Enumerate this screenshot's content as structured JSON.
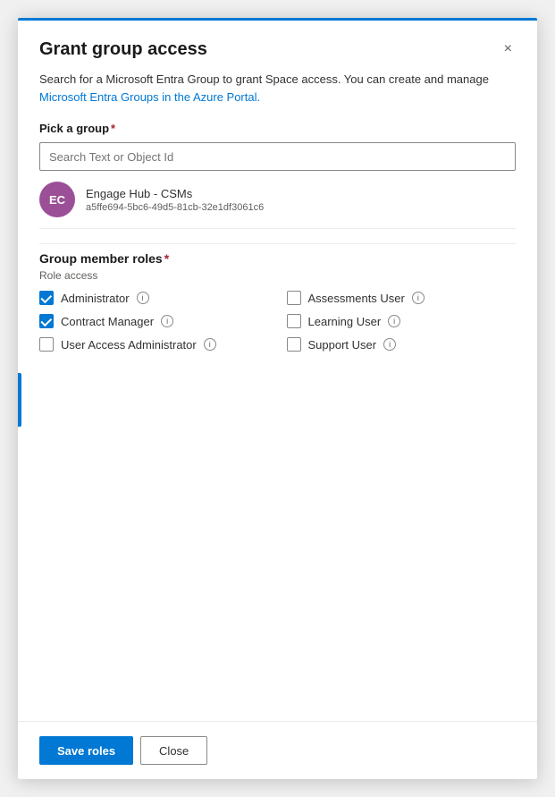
{
  "modal": {
    "title": "Grant group access",
    "close_label": "×"
  },
  "description": {
    "text": "Search for a Microsoft Entra Group to grant Space access. You can create and manage",
    "link_text": "Microsoft Entra Groups in the Azure Portal."
  },
  "group_picker": {
    "label": "Pick a group",
    "required": true,
    "search_placeholder": "Search Text or Object Id"
  },
  "selected_group": {
    "initials": "EC",
    "name": "Engage Hub - CSMs",
    "id": "a5ffe694-5bc6-49d5-81cb-32e1df3061c6"
  },
  "roles_section": {
    "label": "Group member roles",
    "required": true,
    "role_access_label": "Role access"
  },
  "roles": [
    {
      "id": "administrator",
      "label": "Administrator",
      "checked": true,
      "col": 1
    },
    {
      "id": "assessments-user",
      "label": "Assessments User",
      "checked": false,
      "col": 2
    },
    {
      "id": "contract-manager",
      "label": "Contract Manager",
      "checked": true,
      "col": 1
    },
    {
      "id": "learning-user",
      "label": "Learning User",
      "checked": false,
      "col": 2
    },
    {
      "id": "user-access-administrator",
      "label": "User Access Administrator",
      "checked": false,
      "col": 1
    },
    {
      "id": "support-user",
      "label": "Support User",
      "checked": false,
      "col": 2
    }
  ],
  "footer": {
    "save_label": "Save roles",
    "close_label": "Close"
  }
}
